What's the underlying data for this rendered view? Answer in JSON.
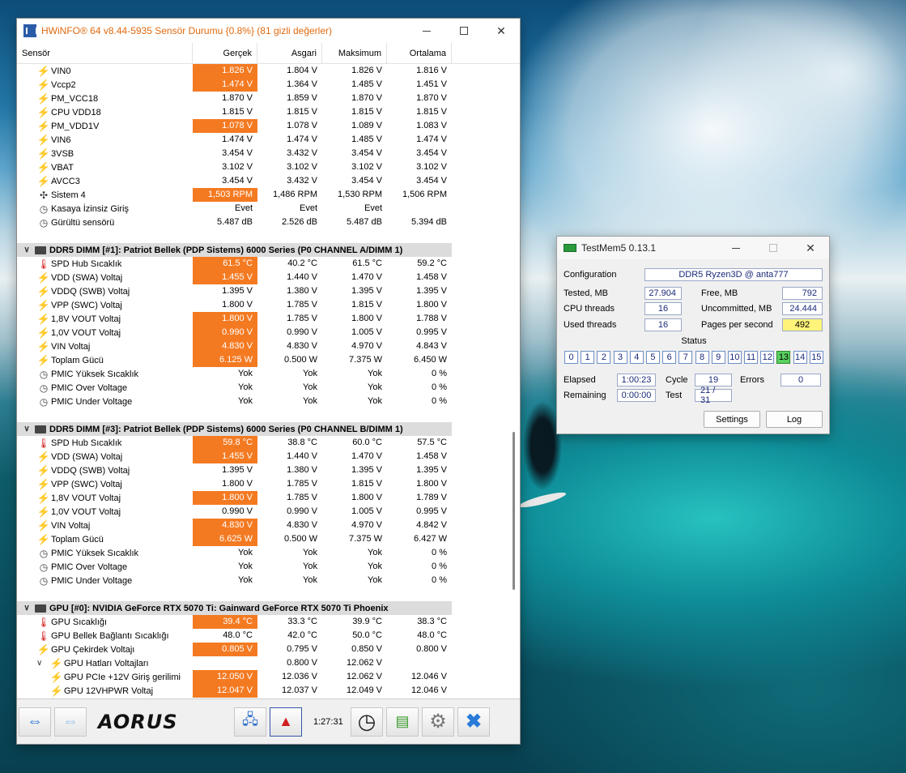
{
  "hwinfo": {
    "title": "HWiNFO® 64 v8.44-5935 Sensör Durumu {0.8%} (81 gizli değerler)",
    "columns": [
      "Sensör",
      "Gerçek",
      "Asgari",
      "Maksimum",
      "Ortalama"
    ],
    "top_rows": [
      {
        "icon": "bolt",
        "name": "VIN0",
        "cur": "1.826 V",
        "min": "1.804 V",
        "max": "1.826 V",
        "avg": "1.816 V",
        "hot": true
      },
      {
        "icon": "bolt",
        "name": "Vccp2",
        "cur": "1.474 V",
        "min": "1.364 V",
        "max": "1.485 V",
        "avg": "1.451 V",
        "hot": true
      },
      {
        "icon": "bolt",
        "name": "PM_VCC18",
        "cur": "1.870 V",
        "min": "1.859 V",
        "max": "1.870 V",
        "avg": "1.870 V",
        "hot": false
      },
      {
        "icon": "bolt",
        "name": "CPU VDD18",
        "cur": "1.815 V",
        "min": "1.815 V",
        "max": "1.815 V",
        "avg": "1.815 V",
        "hot": false
      },
      {
        "icon": "bolt",
        "name": "PM_VDD1V",
        "cur": "1.078 V",
        "min": "1.078 V",
        "max": "1.089 V",
        "avg": "1.083 V",
        "hot": true
      },
      {
        "icon": "bolt",
        "name": "VIN6",
        "cur": "1.474 V",
        "min": "1.474 V",
        "max": "1.485 V",
        "avg": "1.474 V",
        "hot": false
      },
      {
        "icon": "bolt",
        "name": "3VSB",
        "cur": "3.454 V",
        "min": "3.432 V",
        "max": "3.454 V",
        "avg": "3.454 V",
        "hot": false
      },
      {
        "icon": "bolt",
        "name": "VBAT",
        "cur": "3.102 V",
        "min": "3.102 V",
        "max": "3.102 V",
        "avg": "3.102 V",
        "hot": false
      },
      {
        "icon": "bolt",
        "name": "AVCC3",
        "cur": "3.454 V",
        "min": "3.432 V",
        "max": "3.454 V",
        "avg": "3.454 V",
        "hot": false
      },
      {
        "icon": "fan",
        "name": "Sistem 4",
        "cur": "1,503 RPM",
        "min": "1,486 RPM",
        "max": "1,530 RPM",
        "avg": "1,506 RPM",
        "hot": true
      },
      {
        "icon": "clock",
        "name": "Kasaya İzinsiz Giriş",
        "cur": "Evet",
        "min": "Evet",
        "max": "Evet",
        "avg": "",
        "hot": false
      },
      {
        "icon": "clock",
        "name": "Gürültü sensörü",
        "cur": "5.487 dB",
        "min": "2.526 dB",
        "max": "5.487 dB",
        "avg": "5.394 dB",
        "hot": false
      }
    ],
    "dimm1": {
      "title": "DDR5 DIMM [#1]: Patriot Bellek (PDP Sistems) 6000 Series (P0 CHANNEL A/DIMM 1)",
      "rows": [
        {
          "icon": "therm",
          "name": "SPD Hub Sıcaklık",
          "cur": "61.5 °C",
          "min": "40.2 °C",
          "max": "61.5 °C",
          "avg": "59.2 °C",
          "hot": true
        },
        {
          "icon": "bolt",
          "name": "VDD (SWA) Voltaj",
          "cur": "1.455 V",
          "min": "1.440 V",
          "max": "1.470 V",
          "avg": "1.458 V",
          "hot": true
        },
        {
          "icon": "bolt",
          "name": "VDDQ (SWB) Voltaj",
          "cur": "1.395 V",
          "min": "1.380 V",
          "max": "1.395 V",
          "avg": "1.395 V",
          "hot": false
        },
        {
          "icon": "bolt",
          "name": "VPP (SWC) Voltaj",
          "cur": "1.800 V",
          "min": "1.785 V",
          "max": "1.815 V",
          "avg": "1.800 V",
          "hot": false
        },
        {
          "icon": "bolt",
          "name": "1,8V VOUT Voltaj",
          "cur": "1.800 V",
          "min": "1.785 V",
          "max": "1.800 V",
          "avg": "1.788 V",
          "hot": true
        },
        {
          "icon": "bolt",
          "name": "1,0V VOUT Voltaj",
          "cur": "0.990 V",
          "min": "0.990 V",
          "max": "1.005 V",
          "avg": "0.995 V",
          "hot": true
        },
        {
          "icon": "bolt",
          "name": "VIN Voltaj",
          "cur": "4.830 V",
          "min": "4.830 V",
          "max": "4.970 V",
          "avg": "4.843 V",
          "hot": true
        },
        {
          "icon": "bolt",
          "name": "Toplam Gücü",
          "cur": "6.125 W",
          "min": "0.500 W",
          "max": "7.375 W",
          "avg": "6.450 W",
          "hot": true
        },
        {
          "icon": "clock",
          "name": "PMIC Yüksek Sıcaklık",
          "cur": "Yok",
          "min": "Yok",
          "max": "Yok",
          "avg": "0 %",
          "hot": false
        },
        {
          "icon": "clock",
          "name": "PMIC Over Voltage",
          "cur": "Yok",
          "min": "Yok",
          "max": "Yok",
          "avg": "0 %",
          "hot": false
        },
        {
          "icon": "clock",
          "name": "PMIC Under Voltage",
          "cur": "Yok",
          "min": "Yok",
          "max": "Yok",
          "avg": "0 %",
          "hot": false
        }
      ]
    },
    "dimm3": {
      "title": "DDR5 DIMM [#3]: Patriot Bellek (PDP Sistems) 6000 Series (P0 CHANNEL B/DIMM 1)",
      "rows": [
        {
          "icon": "therm",
          "name": "SPD Hub Sıcaklık",
          "cur": "59.8 °C",
          "min": "38.8 °C",
          "max": "60.0 °C",
          "avg": "57.5 °C",
          "hot": true
        },
        {
          "icon": "bolt",
          "name": "VDD (SWA) Voltaj",
          "cur": "1.455 V",
          "min": "1.440 V",
          "max": "1.470 V",
          "avg": "1.458 V",
          "hot": true
        },
        {
          "icon": "bolt",
          "name": "VDDQ (SWB) Voltaj",
          "cur": "1.395 V",
          "min": "1.380 V",
          "max": "1.395 V",
          "avg": "1.395 V",
          "hot": false
        },
        {
          "icon": "bolt",
          "name": "VPP (SWC) Voltaj",
          "cur": "1.800 V",
          "min": "1.785 V",
          "max": "1.815 V",
          "avg": "1.800 V",
          "hot": false
        },
        {
          "icon": "bolt",
          "name": "1,8V VOUT Voltaj",
          "cur": "1.800 V",
          "min": "1.785 V",
          "max": "1.800 V",
          "avg": "1.789 V",
          "hot": true
        },
        {
          "icon": "bolt",
          "name": "1,0V VOUT Voltaj",
          "cur": "0.990 V",
          "min": "0.990 V",
          "max": "1.005 V",
          "avg": "0.995 V",
          "hot": false
        },
        {
          "icon": "bolt",
          "name": "VIN Voltaj",
          "cur": "4.830 V",
          "min": "4.830 V",
          "max": "4.970 V",
          "avg": "4.842 V",
          "hot": true
        },
        {
          "icon": "bolt",
          "name": "Toplam Gücü",
          "cur": "6.625 W",
          "min": "0.500 W",
          "max": "7.375 W",
          "avg": "6.427 W",
          "hot": true
        },
        {
          "icon": "clock",
          "name": "PMIC Yüksek Sıcaklık",
          "cur": "Yok",
          "min": "Yok",
          "max": "Yok",
          "avg": "0 %",
          "hot": false
        },
        {
          "icon": "clock",
          "name": "PMIC Over Voltage",
          "cur": "Yok",
          "min": "Yok",
          "max": "Yok",
          "avg": "0 %",
          "hot": false
        },
        {
          "icon": "clock",
          "name": "PMIC Under Voltage",
          "cur": "Yok",
          "min": "Yok",
          "max": "Yok",
          "avg": "0 %",
          "hot": false
        }
      ]
    },
    "gpu": {
      "title": "GPU [#0]: NVIDIA GeForce RTX 5070 Ti: Gainward GeForce RTX 5070 Ti Phoenix",
      "rows": [
        {
          "icon": "therm",
          "name": "GPU Sıcaklığı",
          "cur": "39.4 °C",
          "min": "33.3 °C",
          "max": "39.9 °C",
          "avg": "38.3 °C",
          "hot": true,
          "indent": 0
        },
        {
          "icon": "therm",
          "name": "GPU Bellek Bağlantı Sıcaklığı",
          "cur": "48.0 °C",
          "min": "42.0 °C",
          "max": "50.0 °C",
          "avg": "48.0 °C",
          "hot": false,
          "indent": 0
        },
        {
          "icon": "bolt",
          "name": "GPU Çekirdek Voltajı",
          "cur": "0.805 V",
          "min": "0.795 V",
          "max": "0.850 V",
          "avg": "0.800 V",
          "hot": true,
          "indent": 0
        },
        {
          "icon": "bolt",
          "name": "GPU Hatları Voltajları",
          "cur": "",
          "min": "0.800 V",
          "max": "12.062 V",
          "avg": "",
          "hot": false,
          "indent": 1,
          "expander": true
        },
        {
          "icon": "bolt",
          "name": "GPU PCIe +12V Giriş gerilimi",
          "cur": "12.050 V",
          "min": "12.036 V",
          "max": "12.062 V",
          "avg": "12.046 V",
          "hot": true,
          "indent": 1
        },
        {
          "icon": "bolt",
          "name": "GPU 12VHPWR Voltaj",
          "cur": "12.047 V",
          "min": "12.037 V",
          "max": "12.049 V",
          "avg": "12.046 V",
          "hot": true,
          "indent": 1
        }
      ]
    },
    "footer": {
      "time": "1:27:31",
      "brand": "AORUS"
    }
  },
  "testmem": {
    "title": "TestMem5   0.13.1",
    "config_label": "Configuration",
    "config_value": "DDR5 Ryzen3D @ anta777",
    "tested_label": "Tested, MB",
    "tested_value": "27.904",
    "free_label": "Free, MB",
    "free_value": "792",
    "cpu_threads_label": "CPU threads",
    "cpu_threads_value": "16",
    "uncommitted_label": "Uncommitted, MB",
    "uncommitted_value": "24.444",
    "used_threads_label": "Used threads",
    "used_threads_value": "16",
    "pages_label": "Pages per second",
    "pages_value": "492",
    "status_label": "Status",
    "status_cells": [
      "0",
      "1",
      "2",
      "3",
      "4",
      "5",
      "6",
      "7",
      "8",
      "9",
      "10",
      "11",
      "12",
      "13",
      "14",
      "15"
    ],
    "active_cell": "13",
    "elapsed_label": "Elapsed",
    "elapsed_value": "1:00:23",
    "cycle_label": "Cycle",
    "cycle_value": "19",
    "errors_label": "Errors",
    "errors_value": "0",
    "remaining_label": "Remaining",
    "remaining_value": "0:00:00",
    "test_label": "Test",
    "test_value": "21 / 31",
    "settings_label": "Settings",
    "log_label": "Log"
  }
}
